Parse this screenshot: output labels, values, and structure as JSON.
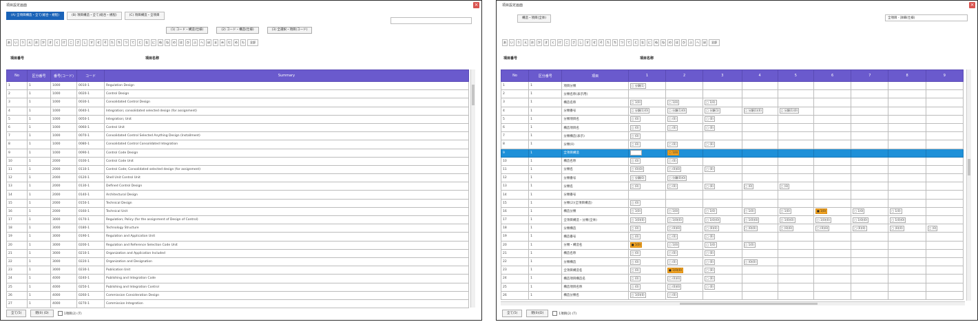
{
  "left_window": {
    "title": "項目設定画面",
    "tabs": [
      "(A) 全項目構造・全て(総合・規程)",
      "(B) 項目構造・全て(総合・規程)",
      "(C) 項目構造・全項目"
    ],
    "subbuttons": [
      "(1) コード・構造(仕様)",
      "(2) コード・構造(仕様)",
      "(3) 全選択・項目(コード)"
    ],
    "letters": [
      "あ",
      "い",
      "う",
      "え",
      "お",
      "か",
      "き",
      "く",
      "け",
      "こ",
      "さ",
      "し",
      "す",
      "せ",
      "そ",
      "た",
      "ち",
      "つ",
      "て",
      "と",
      "な",
      "に",
      "ぬ",
      "ね",
      "の",
      "は",
      "ひ",
      "ふ",
      "へ",
      "ほ",
      "ま",
      "み",
      "む",
      "め",
      "も",
      "全部"
    ],
    "label_a": "項目番号",
    "label_b": "項目名称",
    "columns": [
      "No",
      "区分番号",
      "番号(コード)",
      "コード",
      "Summary"
    ],
    "rows": [
      [
        "1",
        "1",
        "1000",
        "0010-1",
        "Regulation Design"
      ],
      [
        "2",
        "1",
        "1000",
        "0020-1",
        "Control Design"
      ],
      [
        "3",
        "1",
        "1000",
        "0030-1",
        "Consolidated Control Design"
      ],
      [
        "4",
        "1",
        "1000",
        "0040-1",
        "Integration; consolidated selected design (for assignment)"
      ],
      [
        "5",
        "1",
        "1000",
        "0050-1",
        "Integration; Unit"
      ],
      [
        "6",
        "1",
        "1000",
        "0060-1",
        "Control Unit"
      ],
      [
        "7",
        "1",
        "1000",
        "0070-1",
        "Consolidated Control Selected Anything Design (Installment)"
      ],
      [
        "8",
        "1",
        "1000",
        "0080-1",
        "Consolidated Control Consolidated Integration"
      ],
      [
        "9",
        "1",
        "1000",
        "0090-1",
        "Control Code Design"
      ],
      [
        "10",
        "1",
        "2000",
        "0100-1",
        "Control Code Unit"
      ],
      [
        "11",
        "1",
        "2000",
        "0110-1",
        "Control Code; Consolidated selected design (for assignment)"
      ],
      [
        "12",
        "1",
        "2000",
        "0120-1",
        "Shell Unit Control Unit"
      ],
      [
        "13",
        "1",
        "2000",
        "0130-1",
        "Defined Control Design"
      ],
      [
        "14",
        "1",
        "2000",
        "0140-1",
        "Architectural Design"
      ],
      [
        "15",
        "1",
        "2000",
        "0150-1",
        "Technical Design"
      ],
      [
        "16",
        "1",
        "2000",
        "0160-1",
        "Technical Unit"
      ],
      [
        "17",
        "1",
        "3000",
        "0170-1",
        "Regulation; Policy (for the assignment of Design of Control)"
      ],
      [
        "18",
        "1",
        "3000",
        "0180-1",
        "Technology Structure"
      ],
      [
        "19",
        "1",
        "3000",
        "0190-1",
        "Regulation and Application Unit"
      ],
      [
        "20",
        "1",
        "3000",
        "0200-1",
        "Regulation and Reference Selection Code Unit"
      ],
      [
        "21",
        "1",
        "3000",
        "0210-1",
        "Organization and Application Included"
      ],
      [
        "22",
        "1",
        "3000",
        "0220-1",
        "Organization and Designation"
      ],
      [
        "23",
        "1",
        "3000",
        "0230-1",
        "Publication Unit"
      ],
      [
        "24",
        "1",
        "4000",
        "0240-1",
        "Publishing and Integration Code"
      ],
      [
        "25",
        "1",
        "4000",
        "0250-1",
        "Publishing and Integration Control"
      ],
      [
        "26",
        "1",
        "4000",
        "0260-1",
        "Commission Consideration Design"
      ],
      [
        "27",
        "1",
        "4000",
        "0270-1",
        "Commission Integration"
      ]
    ],
    "footer": {
      "btn1": "全て(5)",
      "btn2": "閉(0) (D)",
      "check_label": "1項目(2) (T)"
    }
  },
  "right_window": {
    "title": "項目設定画面",
    "tab": "構造・項目(全体)",
    "select": "全項目 - 詳細(仕様)",
    "letters": [
      "あ",
      "い",
      "う",
      "え",
      "お",
      "か",
      "き",
      "く",
      "け",
      "こ",
      "さ",
      "し",
      "す",
      "せ",
      "そ",
      "た",
      "ち",
      "つ",
      "て",
      "と",
      "な",
      "に",
      "ぬ",
      "ね",
      "の",
      "は",
      "ひ",
      "ふ",
      "へ",
      "ほ",
      "全部"
    ],
    "label_a": "項目番号",
    "label_b": "項目名称",
    "columns": [
      "No",
      "区分番号",
      "項目",
      "1",
      "2",
      "3",
      "4",
      "5",
      "6",
      "7",
      "8",
      "9"
    ],
    "rows": [
      {
        "c": [
          "1",
          "1",
          "項目分類",
          ""
        ],
        "cells": [
          "□ 分類(1)",
          "",
          "",
          "",
          "",
          "",
          "",
          "",
          ""
        ]
      },
      {
        "c": [
          "2",
          "1",
          "分類名称(表示用)",
          ""
        ],
        "cells": [
          "",
          "",
          "",
          "",
          "",
          "",
          "",
          "",
          ""
        ]
      },
      {
        "c": [
          "3",
          "1",
          "構造名称",
          ""
        ],
        "cells": [
          "□ 1(0)",
          "□ 1(0)",
          "□ 1(0)",
          "",
          "",
          "",
          "",
          "",
          ""
        ]
      },
      {
        "c": [
          "4",
          "1",
          "分類番号",
          ""
        ],
        "cells": [
          "□ 分類(1)(0)",
          "□ 分類(1)(0)",
          "□ 分類(1)",
          "□ 分類(1)(0)",
          "□ 分類(1)(0)",
          "",
          "",
          "",
          ""
        ]
      },
      {
        "c": [
          "5",
          "1",
          "分類項目名",
          ""
        ],
        "cells": [
          "□ (0)",
          "□ (0)",
          "□ (0)",
          "",
          "",
          "",
          "",
          "",
          ""
        ]
      },
      {
        "c": [
          "6",
          "1",
          "構造項目名",
          ""
        ],
        "cells": [
          "□ (0)",
          "□ (0)",
          "□ (0)",
          "",
          "",
          "",
          "",
          "",
          ""
        ]
      },
      {
        "c": [
          "7",
          "1",
          "分類構造(表示)",
          ""
        ],
        "cells": [
          "□ (0)",
          "",
          "",
          "",
          "",
          "",
          "",
          "",
          ""
        ]
      },
      {
        "c": [
          "8",
          "1",
          "分類(0)",
          ""
        ],
        "cells": [
          "□ (0)",
          "□ (0)",
          "□ (0)",
          "",
          "",
          "",
          "",
          "",
          ""
        ]
      },
      {
        "c": [
          "9",
          "1",
          "全項目構造",
          ""
        ],
        "cells": [
          "■ 1(0)",
          "□ 1(0)",
          "",
          "",
          "",
          "",
          "",
          "",
          ""
        ]
      },
      {
        "c": [
          "10",
          "1",
          "構造名称",
          ""
        ],
        "cells": [
          "□ (0)",
          "□ (0)",
          "",
          "",
          "",
          "",
          "",
          "",
          ""
        ]
      },
      {
        "c": [
          "11",
          "1",
          "分類名",
          ""
        ],
        "cells": [
          "□ (0)(0)",
          "□ (0)(0)",
          "□ (0)",
          "",
          "",
          "",
          "",
          "",
          ""
        ]
      },
      {
        "c": [
          "12",
          "1",
          "分類番号",
          ""
        ],
        "cells": [
          "□ 分類(0)",
          "□ 分類(0)(0)",
          "",
          "",
          "",
          "",
          "",
          "",
          ""
        ]
      },
      {
        "c": [
          "13",
          "1",
          "分類名",
          ""
        ],
        "cells": [
          "□ (0)",
          "□ (0)",
          "□ (0)",
          "□ (0)",
          "□ (0)",
          "",
          "",
          "",
          ""
        ]
      },
      {
        "c": [
          "14",
          "1",
          "分類番号",
          ""
        ],
        "cells": [
          "",
          "",
          "",
          "",
          "",
          "",
          "",
          "",
          ""
        ]
      },
      {
        "c": [
          "15",
          "1",
          "分類(2)(全項目構造)",
          ""
        ],
        "cells": [
          "□ (0)",
          "",
          "",
          "",
          "",
          "",
          "",
          "",
          ""
        ]
      },
      {
        "c": [
          "16",
          "1",
          "構造分類",
          ""
        ],
        "cells": [
          "□ 1(0)",
          "□ 1(0)",
          "□ 1(0)",
          "□ 1(0)",
          "□ 1(0)",
          "■ 1(0)",
          "□ 1(0)",
          "□ 1(0)",
          ""
        ]
      },
      {
        "c": [
          "17",
          "1",
          "全項目構造・分類(全体)",
          ""
        ],
        "cells": [
          "□ 1(0)(0)",
          "□ 1(0)(0)",
          "□ 1(0)(0)",
          "□ 1(0)(0)",
          "□ 1(0)(0)",
          "□ 1(0)(0)",
          "□ 1(0)(0)",
          "□ 1(0)(0)",
          ""
        ]
      },
      {
        "c": [
          "18",
          "1",
          "分類構造",
          ""
        ],
        "cells": [
          "□ (0)",
          "□ (0)(0)",
          "□ (0)(0)",
          "□ (0)(0)",
          "□ (0)(0)",
          "□ (0)(0)",
          "□ (0)(0)",
          "□ (0)(0)",
          "□ (0)"
        ]
      },
      {
        "c": [
          "19",
          "1",
          "構造番号",
          ""
        ],
        "cells": [
          "□ (0)",
          "□ (0)",
          "□ (0)",
          "",
          "",
          "",
          "",
          "",
          ""
        ]
      },
      {
        "c": [
          "20",
          "1",
          "分類・構造名",
          ""
        ],
        "cells": [
          "■ 1(0)",
          "□ 1(0)",
          "□ 1(0)",
          "□ 1(0)",
          "",
          "",
          "",
          "",
          ""
        ]
      },
      {
        "c": [
          "21",
          "1",
          "構造名称",
          ""
        ],
        "cells": [
          "□ (0)",
          "□ (0)",
          "□ (0)",
          "",
          "",
          "",
          "",
          "",
          ""
        ]
      },
      {
        "c": [
          "22",
          "1",
          "分類構造",
          ""
        ],
        "cells": [
          "□ (0)",
          "□ (0)",
          "□ (0)",
          "□ (0)(0)",
          "",
          "",
          "",
          "",
          ""
        ]
      },
      {
        "c": [
          "23",
          "1",
          "全項目構造名",
          ""
        ],
        "cells": [
          "□ (0)",
          "■ 1(0)(0)",
          "□ (0)",
          "",
          "",
          "",
          "",
          "",
          ""
        ]
      },
      {
        "c": [
          "24",
          "1",
          "構造項目構造名",
          ""
        ],
        "cells": [
          "□ (0)",
          "□ (0)(0)",
          "□ (0)",
          "",
          "",
          "",
          "",
          "",
          ""
        ]
      },
      {
        "c": [
          "25",
          "1",
          "構造項目名称",
          ""
        ],
        "cells": [
          "□ (0)",
          "□ (0)(0)",
          "□ (0)",
          "",
          "",
          "",
          "",
          "",
          ""
        ]
      },
      {
        "c": [
          "26",
          "1",
          "構造分類名",
          ""
        ],
        "cells": [
          "□ 1(0)(0)",
          "□ (0)",
          "",
          "",
          "",
          "",
          "",
          "",
          ""
        ]
      }
    ],
    "selected_row": 8,
    "orange_cells": [
      [
        8,
        1
      ],
      [
        15,
        5
      ],
      [
        19,
        0
      ],
      [
        22,
        1
      ]
    ],
    "footer": {
      "btn1": "全て(5)",
      "btn2": "閉(0)(D)",
      "check_label": "1項目(2) (T)"
    }
  }
}
